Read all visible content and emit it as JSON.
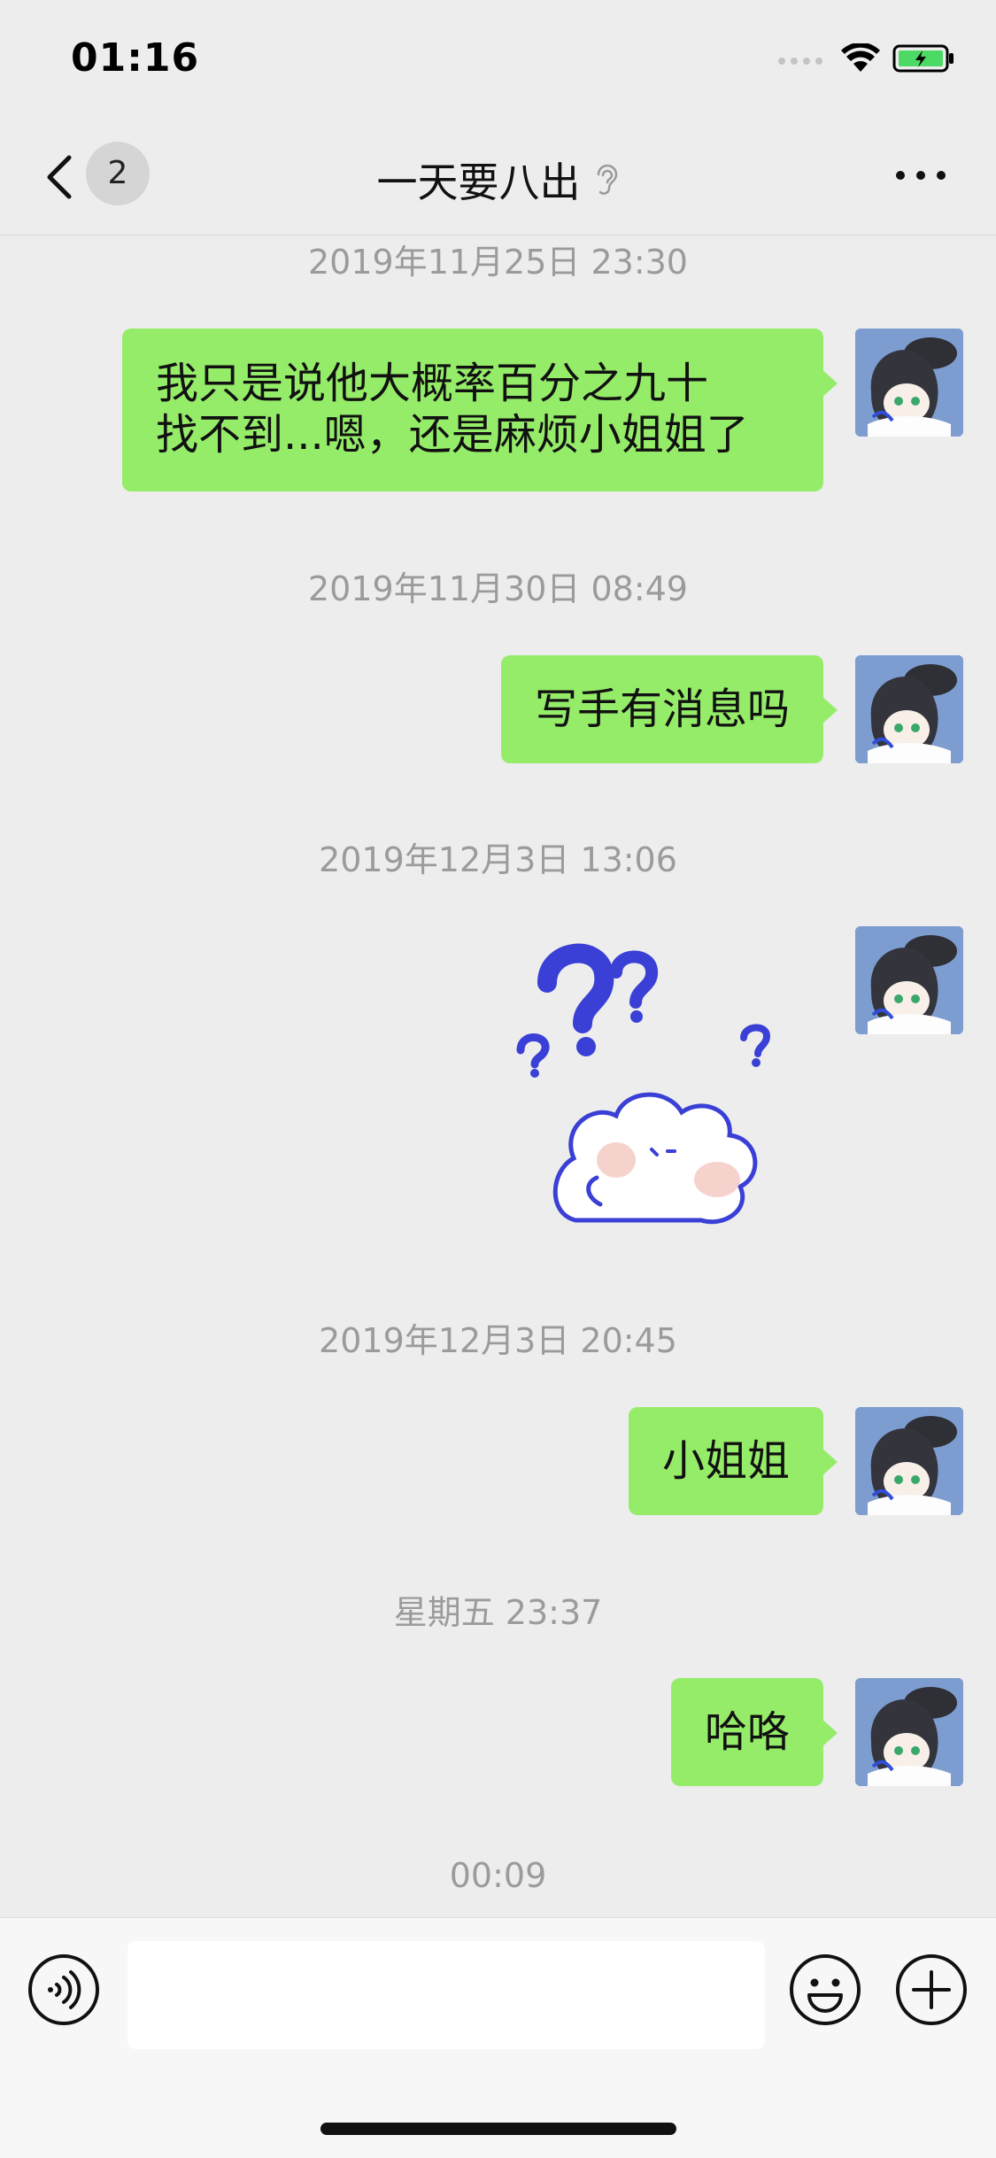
{
  "status_bar": {
    "time": "01:16",
    "battery_color": "#4cd964"
  },
  "nav": {
    "unread_count": "2",
    "title": "一天要八出"
  },
  "messages": [
    {
      "timestamp": "2019年11月25日 23:30",
      "type": "text",
      "lines": [
        "我只是说他大概率百分之九十",
        "找不到...嗯，还是麻烦小姐姐了"
      ]
    },
    {
      "timestamp": "2019年11月30日 08:49",
      "type": "text",
      "text": "写手有消息吗"
    },
    {
      "timestamp": "2019年12月3日 13:06",
      "type": "sticker",
      "sticker": "confused-cloud-sticker"
    },
    {
      "timestamp": "2019年12月3日 20:45",
      "type": "text",
      "text": "小姐姐"
    },
    {
      "timestamp": "星期五 23:37",
      "type": "text",
      "text": "哈咯"
    }
  ],
  "last_timestamp": "00:09",
  "colors": {
    "bubble": "#95ec69",
    "background": "#ededed",
    "timestamp": "#9b9b9b",
    "sticker_ink": "#3a3fd6"
  },
  "icons": {
    "back": "chevron-left-icon",
    "listening": "ear-icon",
    "more": "ellipsis-icon",
    "voice": "voice-icon",
    "emoji": "emoji-icon",
    "plus": "plus-icon"
  }
}
